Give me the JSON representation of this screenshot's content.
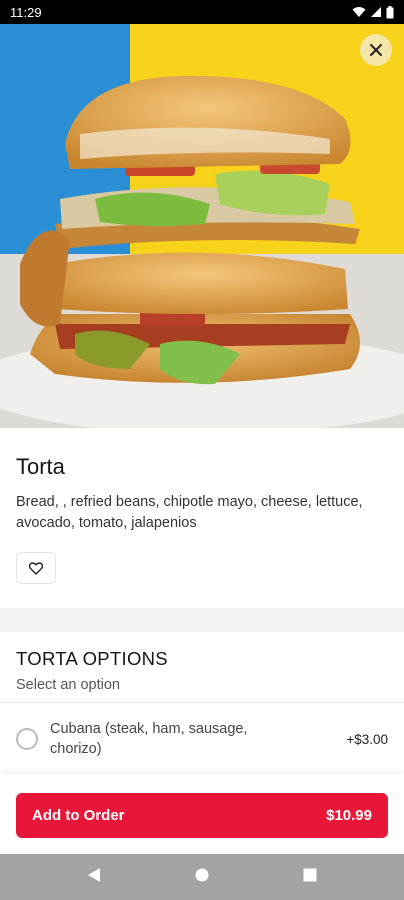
{
  "status_bar": {
    "time": "11:29"
  },
  "hero": {
    "close_icon": "close-icon"
  },
  "item": {
    "title": "Torta",
    "description": "Bread, , refried beans, chipotle mayo, cheese, lettuce, avocado, tomato, jalapenios",
    "favorite_icon": "heart-icon"
  },
  "options": {
    "title": "TORTA OPTIONS",
    "subtitle": "Select an option",
    "items": [
      {
        "label": "Cubana (steak, ham, sausage, chorizo)",
        "price": "+$3.00",
        "selected": false
      }
    ]
  },
  "footer": {
    "add_label": "Add to Order",
    "price": "$10.99",
    "accent": "#e8173a"
  },
  "nav": {
    "back_icon": "back-icon",
    "home_icon": "home-icon",
    "recents_icon": "recents-icon"
  }
}
